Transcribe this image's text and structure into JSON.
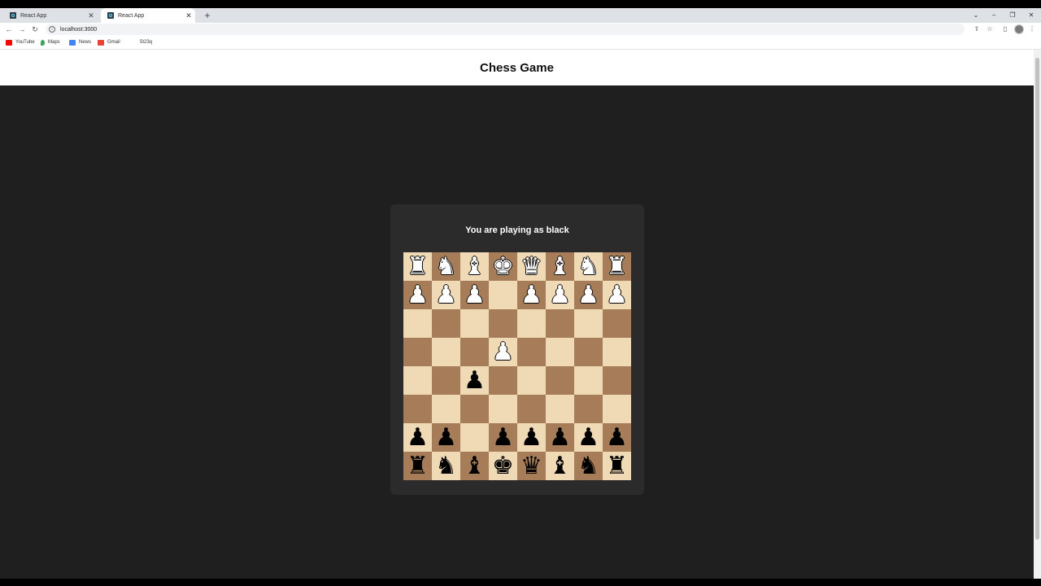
{
  "browser": {
    "tabs": [
      {
        "title": "React App"
      },
      {
        "title": "React App"
      }
    ],
    "url": "localhost:3000",
    "bookmarks": [
      {
        "label": "YouTube",
        "color": "#ff0000"
      },
      {
        "label": "Maps",
        "color": "#34a853"
      },
      {
        "label": "News",
        "color": "#4285f4"
      },
      {
        "label": "Gmail",
        "color": "#ea4335"
      },
      {
        "label": "5t23q",
        "color": ""
      }
    ]
  },
  "app": {
    "title": "Chess Game",
    "status": "You are playing as black"
  },
  "colors": {
    "light_square": "#f0d9b5",
    "dark_square": "#a67d58",
    "background": "#1f1f1f",
    "card": "#2b2b2b"
  },
  "board": [
    [
      "wR",
      "wN",
      "wB",
      "wK",
      "wQ",
      "wB",
      "wN",
      "wR"
    ],
    [
      "wP",
      "wP",
      "wP",
      "",
      "wP",
      "wP",
      "wP",
      "wP"
    ],
    [
      "",
      "",
      "",
      "",
      "",
      "",
      "",
      ""
    ],
    [
      "",
      "",
      "",
      "wP",
      "",
      "",
      "",
      ""
    ],
    [
      "",
      "",
      "bP",
      "",
      "",
      "",
      "",
      ""
    ],
    [
      "",
      "",
      "",
      "",
      "",
      "",
      "",
      ""
    ],
    [
      "bP",
      "bP",
      "",
      "bP",
      "bP",
      "bP",
      "bP",
      "bP"
    ],
    [
      "bR",
      "bN",
      "bB",
      "bK",
      "bQ",
      "bB",
      "bN",
      "bR"
    ]
  ]
}
